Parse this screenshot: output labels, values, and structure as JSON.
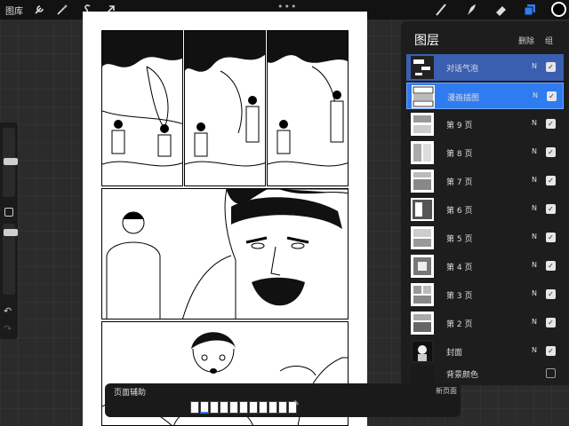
{
  "topbar": {
    "gallery_label": "图库",
    "more_glyph": "•••",
    "tools_left": [
      "wrench-icon",
      "magic-wand-icon",
      "selection-s-icon",
      "transform-arrow-icon"
    ],
    "tools_right": [
      "brush-icon",
      "smudge-icon",
      "eraser-icon",
      "layers-icon"
    ],
    "active_color": "#000000"
  },
  "sidebar": {
    "undo_glyph": "↶",
    "redo_glyph": "↷"
  },
  "layers_panel": {
    "title": "图层",
    "delete_label": "删除",
    "group_label": "组",
    "layers": [
      {
        "name": "对话气泡",
        "mode": "N",
        "checked": "✓",
        "state": "sel1"
      },
      {
        "name": "漫画插图",
        "mode": "N",
        "checked": "✓",
        "state": "sel2"
      },
      {
        "name": "第 9 页",
        "mode": "N",
        "checked": "✓"
      },
      {
        "name": "第 8 页",
        "mode": "N",
        "checked": "✓"
      },
      {
        "name": "第 7 页",
        "mode": "N",
        "checked": "✓"
      },
      {
        "name": "第 6 页",
        "mode": "N",
        "checked": "✓"
      },
      {
        "name": "第 5 页",
        "mode": "N",
        "checked": "✓"
      },
      {
        "name": "第 4 页",
        "mode": "N",
        "checked": "✓"
      },
      {
        "name": "第 3 页",
        "mode": "N",
        "checked": "✓"
      },
      {
        "name": "第 2 页",
        "mode": "N",
        "checked": "✓"
      },
      {
        "name": "封面",
        "mode": "N",
        "checked": "✓"
      },
      {
        "name": "背景颜色",
        "mode": "",
        "checked": ""
      }
    ]
  },
  "page_assist": {
    "title": "页面辅助",
    "new_page_label": "新页面",
    "page_count": 11,
    "active_page_index": 1
  },
  "colors": {
    "accent": "#2f7bf0",
    "selected_secondary": "#3b5fb0",
    "panel_bg": "#1d1d1d"
  }
}
